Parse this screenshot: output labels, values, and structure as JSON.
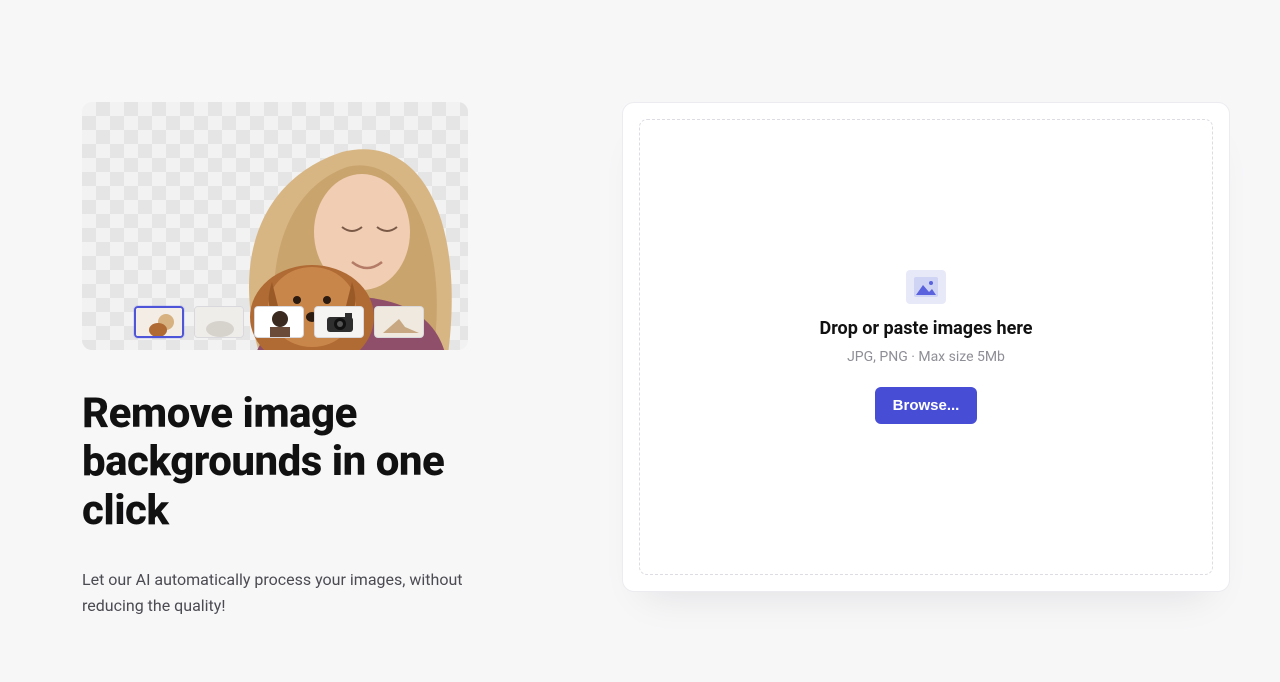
{
  "hero": {
    "alt": "demo-cutout-image",
    "thumbnails": [
      {
        "name": "sample-woman-dog",
        "selected": true
      },
      {
        "name": "sample-object",
        "selected": false
      },
      {
        "name": "sample-portrait",
        "selected": false
      },
      {
        "name": "sample-camera",
        "selected": false
      },
      {
        "name": "sample-yoga",
        "selected": false
      }
    ]
  },
  "headline": "Remove image backgrounds in one click",
  "subhead": "Let our AI automatically process your images, without reducing the quality!",
  "dropzone": {
    "icon": "image-icon",
    "title": "Drop or paste images here",
    "hint": "JPG, PNG · Max size 5Mb",
    "browse_label": "Browse..."
  },
  "colors": {
    "accent": "#474dd5",
    "page_bg": "#f7f7f8",
    "card_bg": "#ffffff"
  }
}
